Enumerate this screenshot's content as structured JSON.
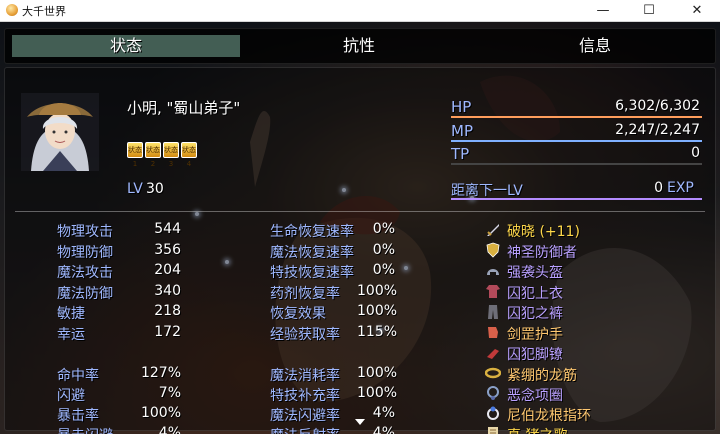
{
  "window": {
    "title": "大千世界",
    "minimize": "—",
    "maximize": "☐",
    "close": "✕"
  },
  "tabs": [
    {
      "label": "状态"
    },
    {
      "label": "抗性"
    },
    {
      "label": "信息"
    }
  ],
  "actor": {
    "name": "小明, \"蜀山弟子\"",
    "level_label": "LV",
    "level": "30",
    "state_icons": [
      "状态1",
      "状态2",
      "状态3",
      "状态4"
    ]
  },
  "gauges": {
    "hp": {
      "label": "HP",
      "value": "6,302/6,302",
      "fraction": 1.0
    },
    "mp": {
      "label": "MP",
      "value": "2,247/2,247",
      "fraction": 1.0
    },
    "tp": {
      "label": "TP",
      "value": "0",
      "fraction": 0
    },
    "exp": {
      "label": "距离下一LV",
      "value": "0",
      "unit": "EXP",
      "fraction": 1.0
    }
  },
  "params": [
    {
      "label": "物理攻击",
      "value": "544"
    },
    {
      "label": "物理防御",
      "value": "356"
    },
    {
      "label": "魔法攻击",
      "value": "204"
    },
    {
      "label": "魔法防御",
      "value": "340"
    },
    {
      "label": "敏捷",
      "value": "218"
    },
    {
      "label": "幸运",
      "value": "172"
    }
  ],
  "xparams": [
    {
      "label": "命中率",
      "value": "127%"
    },
    {
      "label": "闪避",
      "value": "7%"
    },
    {
      "label": "暴击率",
      "value": "100%"
    },
    {
      "label": "暴击闪避",
      "value": "4%"
    }
  ],
  "sparams": [
    {
      "label": "生命恢复速率",
      "value": "0%"
    },
    {
      "label": "魔法恢复速率",
      "value": "0%"
    },
    {
      "label": "特技恢复速率",
      "value": "0%"
    },
    {
      "label": "药剂恢复率",
      "value": "100%"
    },
    {
      "label": "恢复效果",
      "value": "100%"
    },
    {
      "label": "经验获取率",
      "value": "115%"
    }
  ],
  "sparams2": [
    {
      "label": "魔法消耗率",
      "value": "100%"
    },
    {
      "label": "特技补充率",
      "value": "100%"
    },
    {
      "label": "魔法闪避率",
      "value": "4%"
    },
    {
      "label": "魔法反射率",
      "value": "4%"
    }
  ],
  "equipment": [
    {
      "name": "破晓 (+11)",
      "color": "#ffd84a",
      "icon": "sword-icon"
    },
    {
      "name": "神圣防御者",
      "color": "#b9a0ff",
      "icon": "shield-icon"
    },
    {
      "name": "强袭头盔",
      "color": "#b9a0ff",
      "icon": "helmet-icon"
    },
    {
      "name": "囚犯上衣",
      "color": "#b9a0ff",
      "icon": "shirt-icon"
    },
    {
      "name": "囚犯之裤",
      "color": "#b9a0ff",
      "icon": "pants-icon"
    },
    {
      "name": "剑罡护手",
      "color": "#ffc870",
      "icon": "gauntlet-icon"
    },
    {
      "name": "囚犯脚镣",
      "color": "#b9a0ff",
      "icon": "shackle-icon"
    },
    {
      "name": "紧绷的龙筋",
      "color": "#ffc870",
      "icon": "belt-icon"
    },
    {
      "name": "恶念项圈",
      "color": "#b9a0ff",
      "icon": "collar-icon"
    },
    {
      "name": "尼伯龙根指环",
      "color": "#ffc870",
      "icon": "ring-icon"
    },
    {
      "name": "真·猪之歌",
      "color": "#ffd84a",
      "icon": "scroll-icon"
    }
  ],
  "colors": {
    "hp_bar": "#ff9d5c",
    "mp_bar": "#7fb0ff",
    "tp_bar": "#8fe08f",
    "exp_bar": "#b48cff",
    "label_blue": "#9fb8ff"
  }
}
